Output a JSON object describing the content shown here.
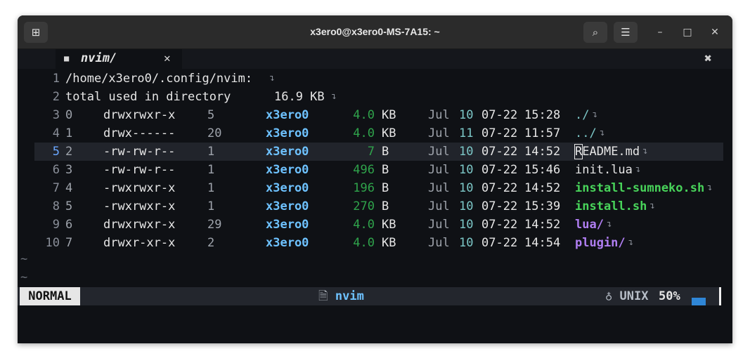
{
  "window": {
    "title": "x3ero0@x3ero0-MS-7A15: ~"
  },
  "icons": {
    "new_tab": "⊞",
    "search": "⌕",
    "menu": "☰",
    "minimize": "–",
    "maximize": "□",
    "close": "✕",
    "tab_file": "■",
    "tab_close": "✕",
    "close_all": "✖",
    "statusline_file": "🗎",
    "statusline_fileformat": "♁",
    "linebreak": "↴"
  },
  "tab": {
    "label": "nvim/"
  },
  "buffer": {
    "header_path": "/home/x3ero0/.config/nvim:",
    "total_label": "total used in directory",
    "total_size": "16.9 KB",
    "entries": [
      {
        "line": "3",
        "idx": "0",
        "perm": "drwxrwxr-x",
        "links": "5",
        "owner": "x3ero0",
        "size": "4.0",
        "unit": "KB",
        "month": "Jul",
        "day": "10",
        "date": "07-22",
        "time": "15:28",
        "name": "./",
        "kind": "dir-dot"
      },
      {
        "line": "4",
        "idx": "1",
        "perm": "drwx------",
        "links": "20",
        "owner": "x3ero0",
        "size": "4.0",
        "unit": "KB",
        "month": "Jul",
        "day": "11",
        "date": "07-22",
        "time": "11:57",
        "name": "../",
        "kind": "dir-dot"
      },
      {
        "line": "5",
        "idx": "2",
        "perm": "-rw-rw-r--",
        "links": "1",
        "owner": "x3ero0",
        "size": "7",
        "unit": "B",
        "month": "Jul",
        "day": "10",
        "date": "07-22",
        "time": "14:52",
        "name": "README.md",
        "kind": "file"
      },
      {
        "line": "6",
        "idx": "3",
        "perm": "-rw-rw-r--",
        "links": "1",
        "owner": "x3ero0",
        "size": "496",
        "unit": "B",
        "month": "Jul",
        "day": "10",
        "date": "07-22",
        "time": "15:46",
        "name": "init.lua",
        "kind": "file"
      },
      {
        "line": "7",
        "idx": "4",
        "perm": "-rwxrwxr-x",
        "links": "1",
        "owner": "x3ero0",
        "size": "196",
        "unit": "B",
        "month": "Jul",
        "day": "10",
        "date": "07-22",
        "time": "14:52",
        "name": "install-sumneko.sh",
        "kind": "exec"
      },
      {
        "line": "8",
        "idx": "5",
        "perm": "-rwxrwxr-x",
        "links": "1",
        "owner": "x3ero0",
        "size": "270",
        "unit": "B",
        "month": "Jul",
        "day": "10",
        "date": "07-22",
        "time": "15:39",
        "name": "install.sh",
        "kind": "exec"
      },
      {
        "line": "9",
        "idx": "6",
        "perm": "drwxrwxr-x",
        "links": "29",
        "owner": "x3ero0",
        "size": "4.0",
        "unit": "KB",
        "month": "Jul",
        "day": "10",
        "date": "07-22",
        "time": "14:52",
        "name": "lua/",
        "kind": "dir"
      },
      {
        "line": "10",
        "idx": "7",
        "perm": "drwxr-xr-x",
        "links": "2",
        "owner": "x3ero0",
        "size": "4.0",
        "unit": "KB",
        "month": "Jul",
        "day": "10",
        "date": "07-22",
        "time": "14:54",
        "name": "plugin/",
        "kind": "dir"
      }
    ],
    "tilde": "~"
  },
  "statusline": {
    "mode": "NORMAL",
    "filename": "nvim",
    "fileformat": "UNIX",
    "percent": "50%"
  }
}
